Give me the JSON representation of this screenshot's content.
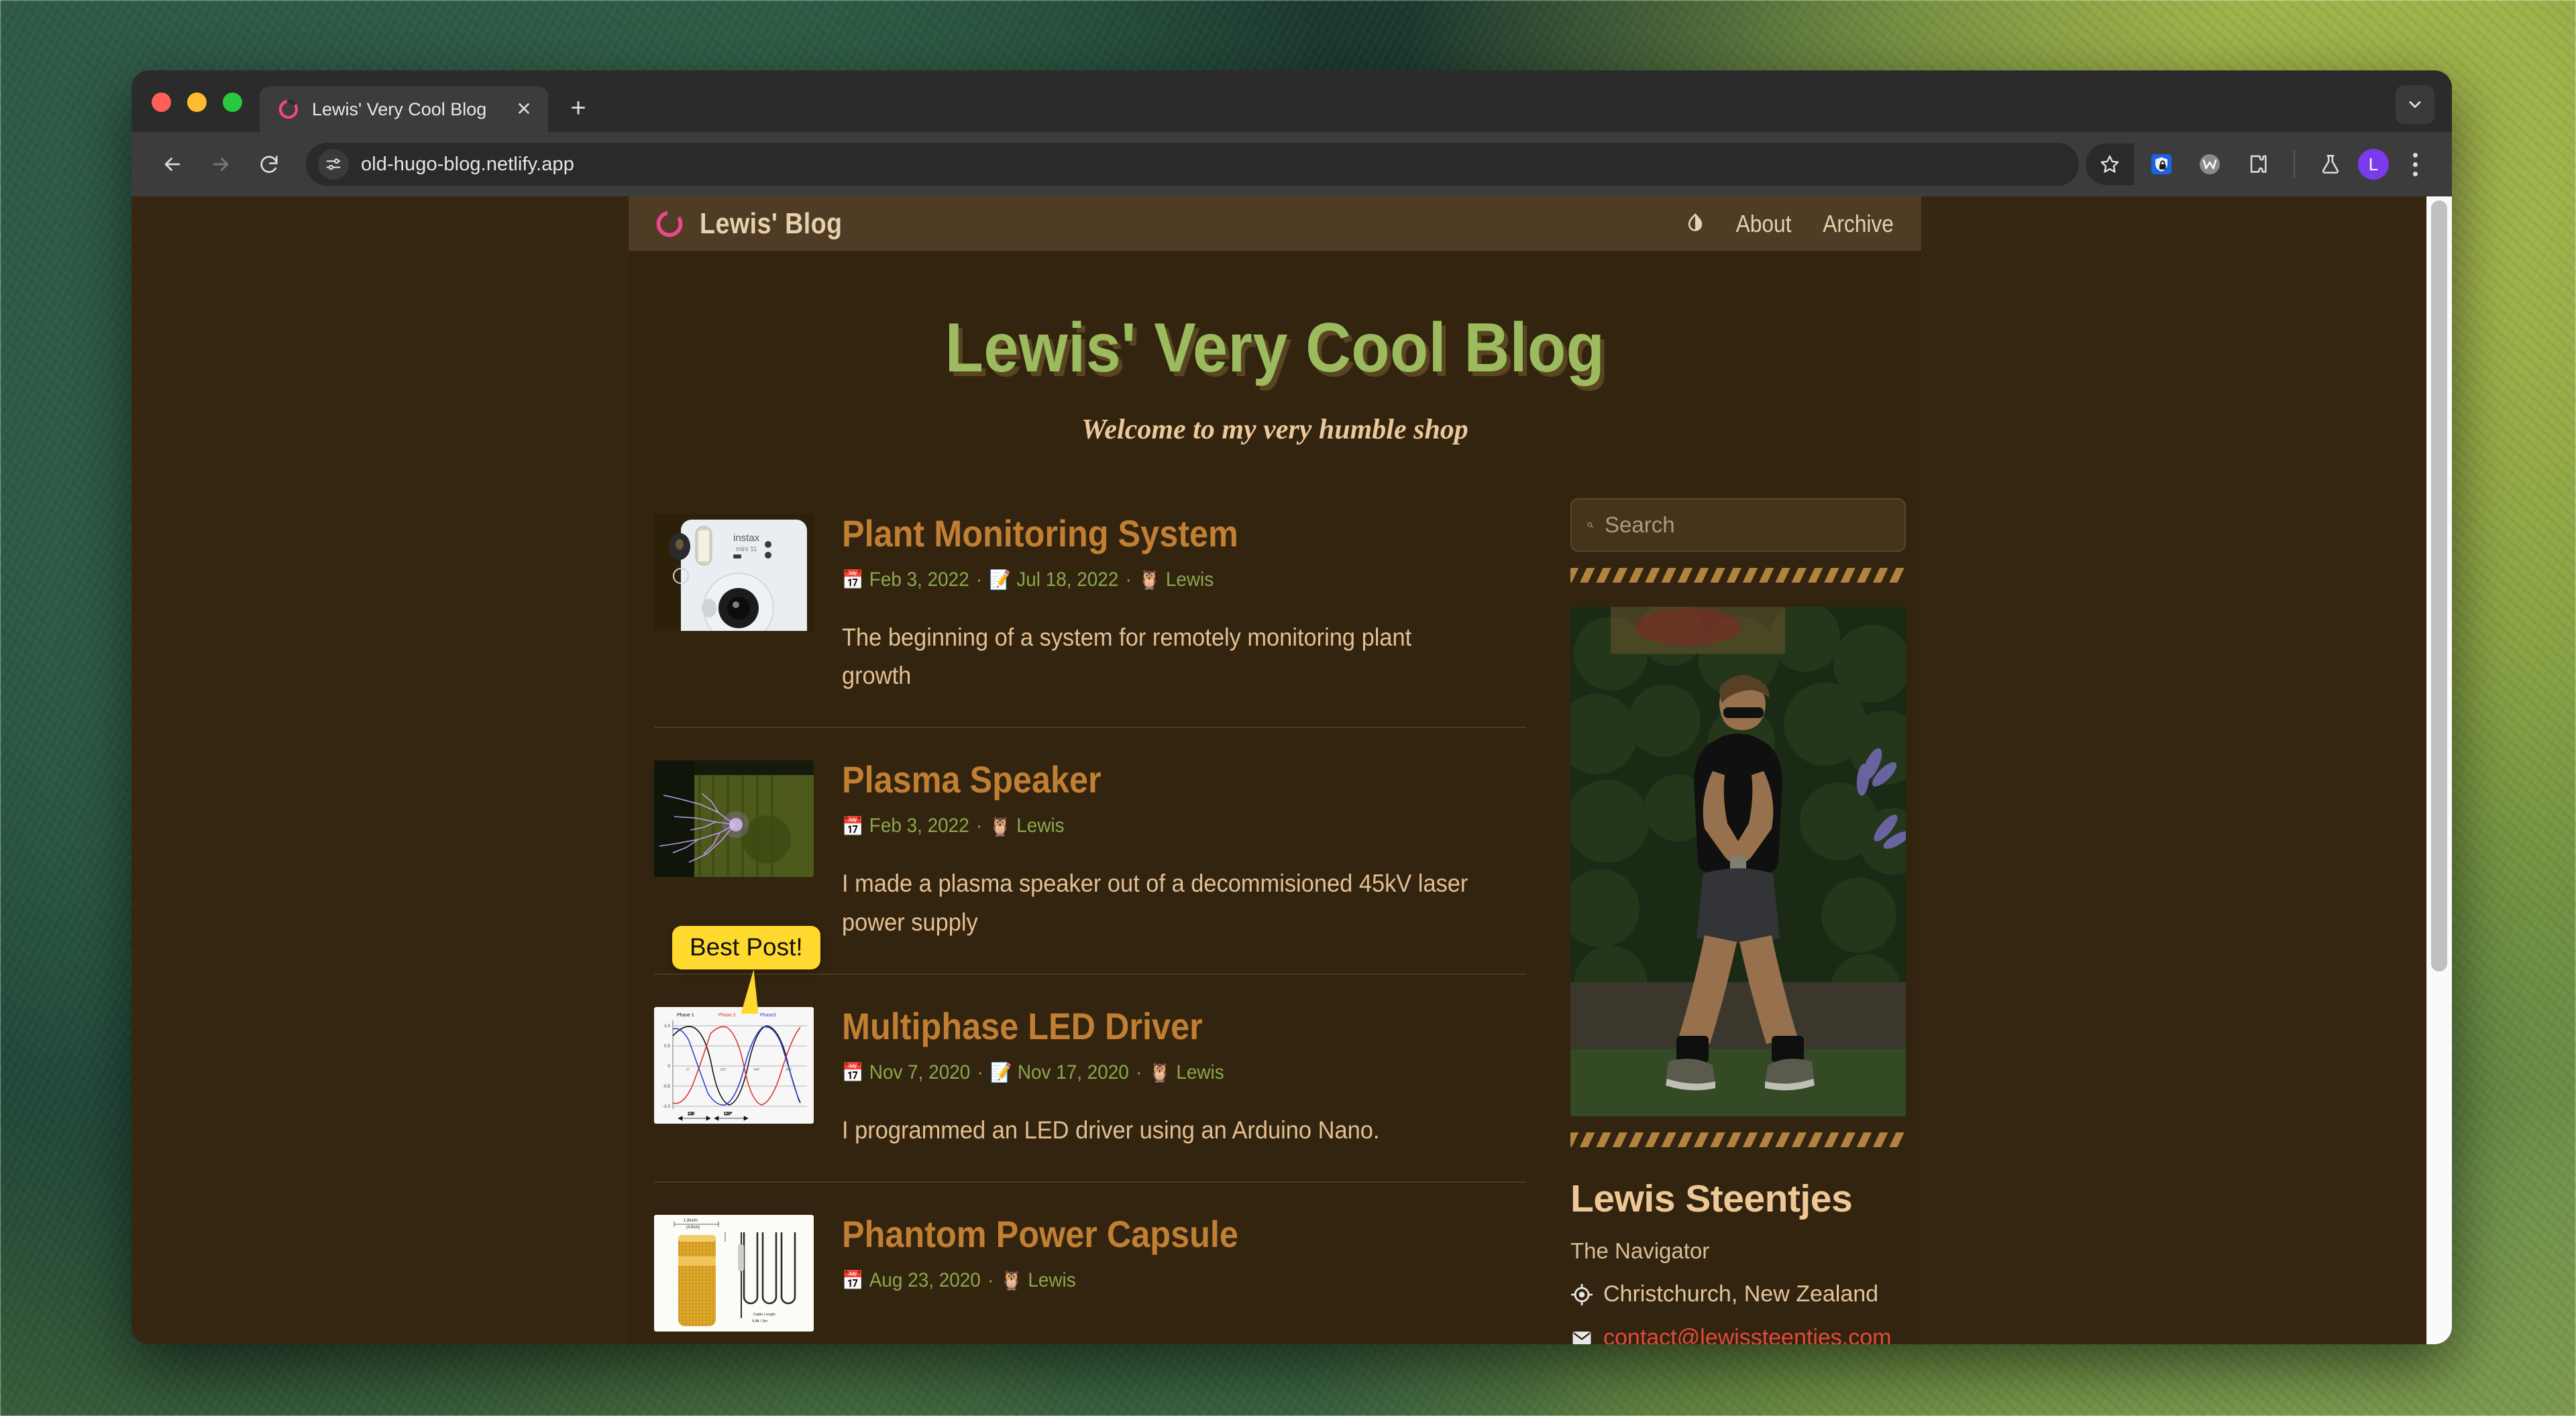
{
  "browser": {
    "tab": {
      "title": "Lewis' Very Cool Blog",
      "favicon": "hugo-ring-icon",
      "close": "✕"
    },
    "new_tab_label": "+",
    "tab_search_icon": "chevron-down-icon",
    "nav": {
      "back": "←",
      "forward": "→",
      "reload": "⟳"
    },
    "omnibox": {
      "url": "old-hugo-blog.netlify.app",
      "site_info_icon": "tune-icon"
    },
    "actions": {
      "bookmark": "star-icon",
      "ext_shield": "shield-lock-icon",
      "ext_w": "w-circle-icon",
      "ext_puzzle": "puzzle-icon",
      "labs": "flask-icon",
      "profile_initial": "L",
      "menu": "kebab-menu-icon"
    }
  },
  "site": {
    "brand": "Lewis' Blog",
    "brand_logo": "pink-ring-icon",
    "theme_toggle_icon": "contrast-droplet-icon",
    "nav_links": [
      "About",
      "Archive"
    ],
    "hero_title": "Lewis' Very Cool Blog",
    "hero_subtitle": "Welcome to my very humble shop"
  },
  "tooltip": {
    "text": "Best Post!",
    "color": "#ffd92e"
  },
  "posts": [
    {
      "title": "Plant Monitoring System",
      "thumb": "instax-camera-photo",
      "meta": [
        {
          "icon": "📅",
          "text": "Feb 3, 2022"
        },
        {
          "icon": "📝",
          "text": "Jul 18, 2022"
        },
        {
          "icon": "🦉",
          "text": "Lewis"
        }
      ],
      "summary": "The beginning of a system for remotely monitoring plant growth"
    },
    {
      "title": "Plasma Speaker",
      "thumb": "plasma-arc-photo",
      "meta": [
        {
          "icon": "📅",
          "text": "Feb 3, 2022"
        },
        {
          "icon": "🦉",
          "text": "Lewis"
        }
      ],
      "summary": "I made a plasma speaker out of a decommisioned 45kV laser power supply"
    },
    {
      "title": "Multiphase LED Driver",
      "thumb": "three-phase-waveform-chart",
      "meta": [
        {
          "icon": "📅",
          "text": "Nov 7, 2020"
        },
        {
          "icon": "📝",
          "text": "Nov 17, 2020"
        },
        {
          "icon": "🦉",
          "text": "Lewis"
        }
      ],
      "summary": "I programmed an LED driver using an Arduino Nano."
    },
    {
      "title": "Phantom Power Capsule",
      "thumb": "microphone-capsule-diagram",
      "meta": [
        {
          "icon": "📅",
          "text": "Aug 23, 2020"
        },
        {
          "icon": "🦉",
          "text": "Lewis"
        }
      ],
      "summary": ""
    }
  ],
  "sidebar": {
    "search_placeholder": "Search",
    "search_value": "",
    "search_icon": "search-icon",
    "photo": "portrait-photo",
    "name": "Lewis Steentjes",
    "role": "The Navigator",
    "location": "Christchurch, New Zealand",
    "location_icon": "crosshair-icon",
    "email": "contact@lewissteentjes.com",
    "email_icon": "envelope-icon"
  },
  "colors": {
    "page_bg": "#372612",
    "column_bg": "#33240f",
    "header_bg": "#4e3c24",
    "title_green": "#9cbb5f",
    "post_title_orange": "#c07f33",
    "meta_green": "#8aa84e",
    "body_cream": "#e3bf94",
    "accent_pink": "#f0468c",
    "email_red": "#e04b3c",
    "tooltip_yellow": "#ffd92e"
  },
  "chart_data": {
    "type": "line",
    "title": "",
    "series": [
      {
        "name": "Phase 1",
        "color": "#000000",
        "phase_deg": 0
      },
      {
        "name": "Phase 2",
        "color": "#e03030",
        "phase_deg": 120
      },
      {
        "name": "Phase 3",
        "color": "#3040d0",
        "phase_deg": 240
      }
    ],
    "ytick_labels": [
      "1.0",
      "0.5",
      "0",
      "-0.5",
      "-1.0"
    ],
    "ylim": [
      -1,
      1
    ],
    "annotations": [
      "120",
      "120°"
    ],
    "grid": true,
    "legend_position": "top"
  }
}
